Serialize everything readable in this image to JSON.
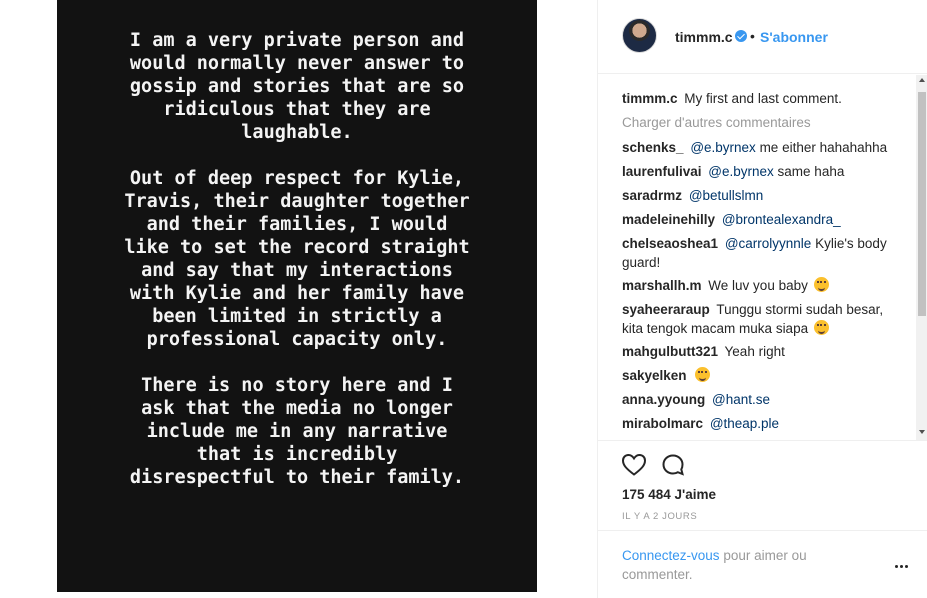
{
  "story": {
    "paragraphs": [
      "I am a very private person and would normally never answer to gossip and stories that are so ridiculous that they are laughable.",
      "Out of deep respect for Kylie, Travis, their daughter together and their families, I would like to set the record straight and say that my interactions with Kylie and her family have been limited in strictly a professional capacity only.",
      "There is no story here and I ask that the media no longer include me in any narrative that is incredibly disrespectful to their family."
    ]
  },
  "header": {
    "username": "timmm.c",
    "separator": "•",
    "follow_label": "S'abonner"
  },
  "caption": {
    "username": "timmm.c",
    "text": "My first and last comment."
  },
  "load_more_label": "Charger d'autres commentaires",
  "comments": [
    {
      "username": "schenks_",
      "mention": "@e.byrnex",
      "text": "me either hahahahha"
    },
    {
      "username": "laurenfulivai",
      "mention": "@e.byrnex",
      "text": "same haha"
    },
    {
      "username": "saradrmz",
      "mention": "@betullslmn",
      "text": ""
    },
    {
      "username": "madeleinehilly",
      "mention": "@brontealexandra_",
      "text": ""
    },
    {
      "username": "chelseaoshea1",
      "mention": "@carrolyynnle",
      "text": "Kylie's body guard!"
    },
    {
      "username": "marshallh.m",
      "mention": "",
      "text": "We luv you baby",
      "emoji": "kissing-face"
    },
    {
      "username": "syaheeraraup",
      "mention": "",
      "text": "Tunggu stormi sudah besar, kita tengok macam muka siapa",
      "emoji": "tongue-face"
    },
    {
      "username": "mahgulbutt321",
      "mention": "",
      "text": "Yeah right"
    },
    {
      "username": "sakyelken",
      "mention": "",
      "text": "",
      "emoji": "upside-down-face"
    },
    {
      "username": "anna.yyoung",
      "mention": "@hant.se",
      "text": ""
    },
    {
      "username": "mirabolmarc",
      "mention": "@theap.ple",
      "text": ""
    }
  ],
  "actions": {
    "likes": "175 484 J'aime",
    "timestamp": "IL Y A 2 JOURS"
  },
  "login": {
    "link": "Connectez-vous",
    "rest": "pour aimer ou commenter."
  },
  "icons": {
    "like": "heart-outline-icon",
    "comment": "speech-bubble-icon",
    "more": "ellipsis-icon",
    "verified": "verified-badge-icon"
  },
  "colors": {
    "accent": "#3897f0",
    "mention": "#003569",
    "muted": "#999999",
    "story_bg": "#121212"
  }
}
